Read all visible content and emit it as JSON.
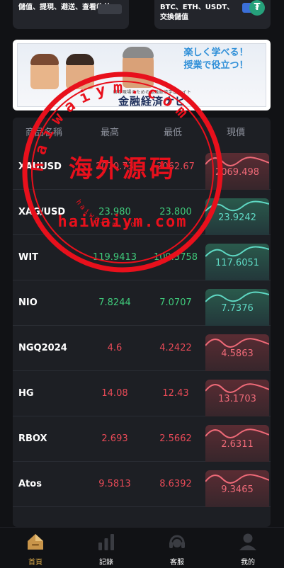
{
  "top_cards": {
    "left_text": "儲值、提現、避送、查看收益",
    "right_text": "BTC、ETH、USDT、交換儲值"
  },
  "banner": {
    "slogan_line1": "楽しく学べる！",
    "slogan_line2": "授業で役立つ！",
    "subtitle": "教育現場のための金融経済学習サイト",
    "title": "金融経済ナビ"
  },
  "market": {
    "headers": {
      "name": "商品名稱",
      "high": "最高",
      "low": "最低",
      "now": "現價"
    },
    "rows": [
      {
        "symbol": "XAUUSD",
        "high": "2070.73",
        "low": "2062.67",
        "now": "2069.498",
        "trend": "down"
      },
      {
        "symbol": "XAG/USD",
        "high": "23.980",
        "low": "23.800",
        "now": "23.9242",
        "trend": "up"
      },
      {
        "symbol": "WIT",
        "high": "119.9413",
        "low": "109.3758",
        "now": "117.6051",
        "trend": "up"
      },
      {
        "symbol": "NIO",
        "high": "7.8244",
        "low": "7.0707",
        "now": "7.7376",
        "trend": "up"
      },
      {
        "symbol": "NGQ2024",
        "high": "4.6",
        "low": "4.2422",
        "now": "4.5863",
        "trend": "down"
      },
      {
        "symbol": "HG",
        "high": "14.08",
        "low": "12.43",
        "now": "13.1703",
        "trend": "down"
      },
      {
        "symbol": "RBOX",
        "high": "2.693",
        "low": "2.5662",
        "now": "2.6311",
        "trend": "down"
      },
      {
        "symbol": "Atos",
        "high": "9.5813",
        "low": "8.6392",
        "now": "9.3465",
        "trend": "down"
      }
    ]
  },
  "watermark": {
    "center_text": "海外源码",
    "url_text": "haiwaiym.com",
    "ring_text": "haiwaiym.com",
    "small_text": "haiwaiym.com"
  },
  "nav": {
    "items": [
      {
        "label": "首頁",
        "icon": "home-icon",
        "active": true
      },
      {
        "label": "記錄",
        "icon": "bar-chart-icon",
        "active": false
      },
      {
        "label": "客服",
        "icon": "headset-icon",
        "active": false
      },
      {
        "label": "我的",
        "icon": "user-icon",
        "active": false
      }
    ]
  },
  "colors": {
    "up": "#3fc97a",
    "down": "#e84a57",
    "accent": "#d8a84a",
    "stamp": "#e8101c"
  }
}
